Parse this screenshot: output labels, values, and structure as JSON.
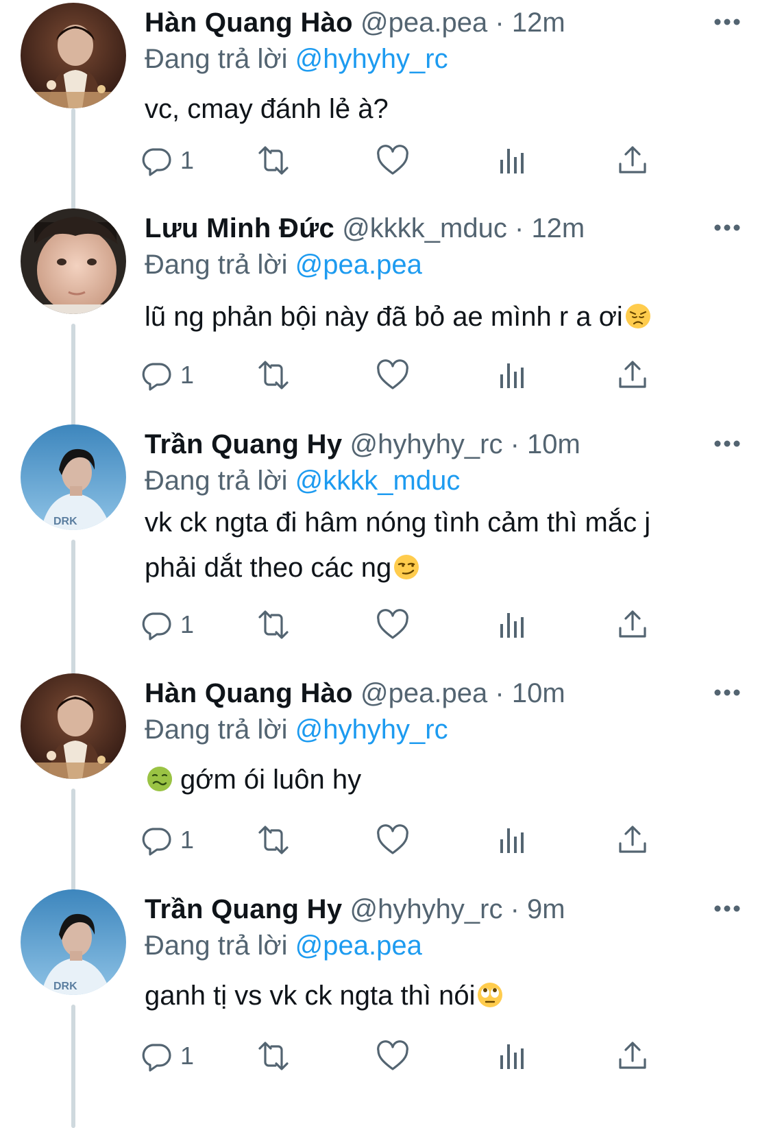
{
  "replying_prefix": "Đang trả lời",
  "tweets": [
    {
      "name": "Hàn Quang Hào",
      "handle": "@pea.pea",
      "separator": "·",
      "time": "12m",
      "replying_to": "@hyhyhy_rc",
      "text": "vc, cmay đánh lẻ à?",
      "emoji": "",
      "reply_count": "1"
    },
    {
      "name": "Lưu Minh Đức",
      "handle": "@kkkk_mduc",
      "separator": "·",
      "time": "12m",
      "replying_to": "@pea.pea",
      "text": "lũ ng phản bội này đã bỏ ae mình r a ơi",
      "emoji": "disappointed-face",
      "reply_count": "1"
    },
    {
      "name": "Trần Quang Hy",
      "handle": "@hyhyhy_rc",
      "separator": "·",
      "time": "10m",
      "replying_to": "@kkkk_mduc",
      "text": "vk ck ngta đi hâm nóng tình cảm thì mắc j phải dắt theo các ng",
      "emoji": "smirking-face",
      "reply_count": "1"
    },
    {
      "name": "Hàn Quang Hào",
      "handle": "@pea.pea",
      "separator": "·",
      "time": "10m",
      "replying_to": "@hyhyhy_rc",
      "text": "gớm ói luôn hy",
      "emoji": "nauseated-face",
      "reply_count": "1"
    },
    {
      "name": "Trần Quang Hy",
      "handle": "@hyhyhy_rc",
      "separator": "·",
      "time": "9m",
      "replying_to": "@pea.pea",
      "text": "ganh tị vs vk ck ngta thì nói",
      "emoji": "face-with-rolling-eyes",
      "reply_count": "1"
    }
  ],
  "colors": {
    "text": "#0f1419",
    "secondary": "#536471",
    "link": "#1d9bf0",
    "thread_line": "#cfd9de"
  }
}
